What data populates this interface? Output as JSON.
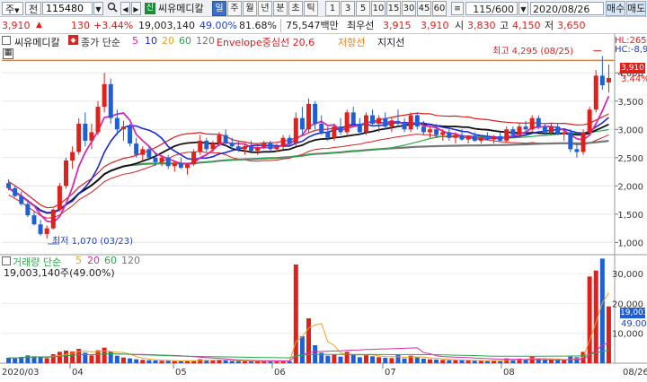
{
  "toolbar": {
    "market": "주",
    "prev_label": "전",
    "code": "115480",
    "mode_badge": "신",
    "stock_name": "씨유메디칼",
    "period_buttons": [
      "일",
      "주",
      "월",
      "년",
      "분",
      "초",
      "틱"
    ],
    "minute_buttons": [
      "1",
      "3",
      "5",
      "10",
      "15",
      "30",
      "45",
      "60"
    ],
    "count": "115/600",
    "date": "2020/08/26",
    "buy_label": "매수",
    "sell_label": "매도"
  },
  "quote": {
    "price": "3,910",
    "change": "130",
    "change_rate": "+3.44%",
    "volume": "19,003,140",
    "ratio1": "49.00%",
    "ratio2": "81.68%",
    "amount": "75,547백만",
    "best_ask_label": "최우선",
    "best_ask": "3,915",
    "best_bid": "3,910",
    "open_label": "시",
    "open": "3,830",
    "high_label": "고",
    "high": "4,150",
    "low_label": "저",
    "low": "3,650"
  },
  "chart_header": {
    "name": "씨유메디칼",
    "ma_label": "종가 단순",
    "ma_periods": [
      "5",
      "10",
      "20",
      "60",
      "120"
    ],
    "envelope": "Envelope중심선 20,6",
    "resistance": "저항선",
    "support": "지지선"
  },
  "annotations": {
    "high_note": "최고 4,295 (08/25)",
    "low_note": "최저 1,070 (03/23)",
    "hl_top": "HL:265,",
    "hc_top": "HC:-8,9",
    "price_tag": "3,910",
    "rate_tag": "3.44%",
    "vol_tag": "19,003",
    "vol_pct_tag": "49.00%"
  },
  "volume_header": {
    "label": "거래량 단순",
    "periods": [
      "5",
      "20",
      "60",
      "120"
    ],
    "summary": "19,003,140주(49.00%)"
  },
  "colors": {
    "up": "#e0201b",
    "down": "#1f5fd6",
    "ma5": "#d62bb0",
    "ma10": "#1c2bd0",
    "ma20": "#f0a020",
    "ma60": "#2aa84a",
    "ma120": "#777777",
    "env_upper": "#d92020",
    "env_mid": "#111111",
    "resistance": "#ff7a00"
  },
  "chart_data": {
    "type": "candlestick",
    "price_axis": {
      "ticks": [
        1000,
        1500,
        2000,
        2500,
        3000,
        3500,
        4000
      ],
      "ylim": [
        800,
        4400
      ]
    },
    "volume_axis": {
      "ticks": [
        10000,
        20000,
        30000
      ],
      "unit": "천주",
      "ylim": [
        0,
        36000
      ]
    },
    "x_labels": [
      "2020/03",
      "04",
      "05",
      "06",
      "07",
      "08",
      "08/26"
    ],
    "high": 4295,
    "low": 1070,
    "last_close": 3910,
    "candles": [
      {
        "o": 2050,
        "h": 2120,
        "l": 1920,
        "c": 1960,
        "v": 1800
      },
      {
        "o": 1960,
        "h": 2000,
        "l": 1800,
        "c": 1820,
        "v": 1600
      },
      {
        "o": 1820,
        "h": 1900,
        "l": 1650,
        "c": 1680,
        "v": 2100
      },
      {
        "o": 1680,
        "h": 1750,
        "l": 1450,
        "c": 1480,
        "v": 2600
      },
      {
        "o": 1480,
        "h": 1560,
        "l": 1300,
        "c": 1320,
        "v": 2300
      },
      {
        "o": 1320,
        "h": 1400,
        "l": 1120,
        "c": 1150,
        "v": 2000
      },
      {
        "o": 1150,
        "h": 1300,
        "l": 1070,
        "c": 1250,
        "v": 1700
      },
      {
        "o": 1250,
        "h": 1600,
        "l": 1230,
        "c": 1580,
        "v": 3000
      },
      {
        "o": 1580,
        "h": 2050,
        "l": 1550,
        "c": 2000,
        "v": 3800
      },
      {
        "o": 2000,
        "h": 2500,
        "l": 1950,
        "c": 2450,
        "v": 4200
      },
      {
        "o": 2450,
        "h": 2700,
        "l": 2300,
        "c": 2600,
        "v": 3900
      },
      {
        "o": 2600,
        "h": 3200,
        "l": 2550,
        "c": 3100,
        "v": 4800
      },
      {
        "o": 3100,
        "h": 3300,
        "l": 2700,
        "c": 2800,
        "v": 3500
      },
      {
        "o": 2800,
        "h": 3100,
        "l": 2650,
        "c": 2950,
        "v": 2600
      },
      {
        "o": 2950,
        "h": 3500,
        "l": 2900,
        "c": 3400,
        "v": 4300
      },
      {
        "o": 3400,
        "h": 4000,
        "l": 3300,
        "c": 3800,
        "v": 5200
      },
      {
        "o": 3800,
        "h": 3900,
        "l": 3100,
        "c": 3200,
        "v": 3900
      },
      {
        "o": 3200,
        "h": 3350,
        "l": 2900,
        "c": 3000,
        "v": 2500
      },
      {
        "o": 3000,
        "h": 3150,
        "l": 2800,
        "c": 3050,
        "v": 1900
      },
      {
        "o": 3050,
        "h": 3100,
        "l": 2700,
        "c": 2750,
        "v": 1600
      },
      {
        "o": 2750,
        "h": 2850,
        "l": 2500,
        "c": 2550,
        "v": 1300
      },
      {
        "o": 2550,
        "h": 2700,
        "l": 2450,
        "c": 2650,
        "v": 1100
      },
      {
        "o": 2650,
        "h": 2700,
        "l": 2450,
        "c": 2500,
        "v": 1000
      },
      {
        "o": 2500,
        "h": 2600,
        "l": 2350,
        "c": 2420,
        "v": 900
      },
      {
        "o": 2420,
        "h": 2550,
        "l": 2350,
        "c": 2500,
        "v": 800
      },
      {
        "o": 2500,
        "h": 2550,
        "l": 2300,
        "c": 2350,
        "v": 800
      },
      {
        "o": 2350,
        "h": 2450,
        "l": 2250,
        "c": 2400,
        "v": 700
      },
      {
        "o": 2400,
        "h": 2500,
        "l": 2300,
        "c": 2320,
        "v": 700
      },
      {
        "o": 2320,
        "h": 2400,
        "l": 2200,
        "c": 2380,
        "v": 700
      },
      {
        "o": 2380,
        "h": 2650,
        "l": 2350,
        "c": 2600,
        "v": 900
      },
      {
        "o": 2600,
        "h": 2900,
        "l": 2550,
        "c": 2800,
        "v": 1300
      },
      {
        "o": 2800,
        "h": 2850,
        "l": 2600,
        "c": 2650,
        "v": 1000
      },
      {
        "o": 2650,
        "h": 2800,
        "l": 2600,
        "c": 2750,
        "v": 900
      },
      {
        "o": 2750,
        "h": 2950,
        "l": 2700,
        "c": 2900,
        "v": 1100
      },
      {
        "o": 2900,
        "h": 3000,
        "l": 2700,
        "c": 2750,
        "v": 900
      },
      {
        "o": 2750,
        "h": 2850,
        "l": 2650,
        "c": 2700,
        "v": 700
      },
      {
        "o": 2700,
        "h": 2800,
        "l": 2600,
        "c": 2650,
        "v": 700
      },
      {
        "o": 2650,
        "h": 2750,
        "l": 2550,
        "c": 2700,
        "v": 650
      },
      {
        "o": 2700,
        "h": 2800,
        "l": 2600,
        "c": 2620,
        "v": 650
      },
      {
        "o": 2620,
        "h": 2700,
        "l": 2550,
        "c": 2680,
        "v": 600
      },
      {
        "o": 2680,
        "h": 2800,
        "l": 2650,
        "c": 2750,
        "v": 650
      },
      {
        "o": 2750,
        "h": 2800,
        "l": 2600,
        "c": 2650,
        "v": 600
      },
      {
        "o": 2650,
        "h": 2750,
        "l": 2600,
        "c": 2700,
        "v": 600
      },
      {
        "o": 2700,
        "h": 2900,
        "l": 2650,
        "c": 2850,
        "v": 900
      },
      {
        "o": 2850,
        "h": 2900,
        "l": 2700,
        "c": 2750,
        "v": 700
      },
      {
        "o": 2750,
        "h": 3300,
        "l": 2700,
        "c": 3200,
        "v": 33000
      },
      {
        "o": 3200,
        "h": 3400,
        "l": 2900,
        "c": 3000,
        "v": 9000
      },
      {
        "o": 3000,
        "h": 3550,
        "l": 2950,
        "c": 3450,
        "v": 15000
      },
      {
        "o": 3450,
        "h": 3500,
        "l": 3000,
        "c": 3100,
        "v": 6000
      },
      {
        "o": 3100,
        "h": 3250,
        "l": 2900,
        "c": 2950,
        "v": 3500
      },
      {
        "o": 2950,
        "h": 3050,
        "l": 2800,
        "c": 2850,
        "v": 2500
      },
      {
        "o": 2850,
        "h": 3100,
        "l": 2800,
        "c": 3050,
        "v": 2800
      },
      {
        "o": 3050,
        "h": 3200,
        "l": 2900,
        "c": 2950,
        "v": 2200
      },
      {
        "o": 2950,
        "h": 3350,
        "l": 2900,
        "c": 3300,
        "v": 3800
      },
      {
        "o": 3300,
        "h": 3400,
        "l": 3050,
        "c": 3100,
        "v": 2900
      },
      {
        "o": 3100,
        "h": 3200,
        "l": 2900,
        "c": 2950,
        "v": 2000
      },
      {
        "o": 2950,
        "h": 3300,
        "l": 2900,
        "c": 3250,
        "v": 3000
      },
      {
        "o": 3250,
        "h": 3350,
        "l": 3050,
        "c": 3100,
        "v": 2300
      },
      {
        "o": 3100,
        "h": 3250,
        "l": 2950,
        "c": 3200,
        "v": 2000
      },
      {
        "o": 3200,
        "h": 3300,
        "l": 3000,
        "c": 3050,
        "v": 1800
      },
      {
        "o": 3050,
        "h": 3200,
        "l": 2950,
        "c": 3150,
        "v": 1700
      },
      {
        "o": 3150,
        "h": 3350,
        "l": 3050,
        "c": 3100,
        "v": 2800
      },
      {
        "o": 3100,
        "h": 3200,
        "l": 2950,
        "c": 3000,
        "v": 1600
      },
      {
        "o": 3000,
        "h": 3300,
        "l": 2950,
        "c": 3250,
        "v": 2500
      },
      {
        "o": 3250,
        "h": 3300,
        "l": 3000,
        "c": 3050,
        "v": 1900
      },
      {
        "o": 3050,
        "h": 3150,
        "l": 2900,
        "c": 2950,
        "v": 1500
      },
      {
        "o": 2950,
        "h": 3050,
        "l": 2850,
        "c": 3000,
        "v": 1300
      },
      {
        "o": 3000,
        "h": 3100,
        "l": 2850,
        "c": 2900,
        "v": 1200
      },
      {
        "o": 2900,
        "h": 3000,
        "l": 2800,
        "c": 2950,
        "v": 1100
      },
      {
        "o": 2950,
        "h": 3000,
        "l": 2800,
        "c": 2850,
        "v": 1000
      },
      {
        "o": 2850,
        "h": 2950,
        "l": 2750,
        "c": 2900,
        "v": 1000
      },
      {
        "o": 2900,
        "h": 3000,
        "l": 2800,
        "c": 2820,
        "v": 900
      },
      {
        "o": 2820,
        "h": 2900,
        "l": 2750,
        "c": 2880,
        "v": 900
      },
      {
        "o": 2880,
        "h": 2950,
        "l": 2780,
        "c": 2800,
        "v": 800
      },
      {
        "o": 2800,
        "h": 2900,
        "l": 2750,
        "c": 2850,
        "v": 800
      },
      {
        "o": 2850,
        "h": 2950,
        "l": 2800,
        "c": 2820,
        "v": 700
      },
      {
        "o": 2820,
        "h": 2900,
        "l": 2750,
        "c": 2880,
        "v": 800
      },
      {
        "o": 2880,
        "h": 2950,
        "l": 2780,
        "c": 2800,
        "v": 700
      },
      {
        "o": 2800,
        "h": 3050,
        "l": 2780,
        "c": 3000,
        "v": 1600
      },
      {
        "o": 3000,
        "h": 3050,
        "l": 2850,
        "c": 2900,
        "v": 1100
      },
      {
        "o": 2900,
        "h": 3100,
        "l": 2850,
        "c": 3050,
        "v": 1500
      },
      {
        "o": 3050,
        "h": 3150,
        "l": 2950,
        "c": 3000,
        "v": 1300
      },
      {
        "o": 3000,
        "h": 3250,
        "l": 2950,
        "c": 3200,
        "v": 2200
      },
      {
        "o": 3200,
        "h": 3250,
        "l": 3000,
        "c": 3050,
        "v": 1600
      },
      {
        "o": 3050,
        "h": 3100,
        "l": 2900,
        "c": 2950,
        "v": 1200
      },
      {
        "o": 2950,
        "h": 3100,
        "l": 2900,
        "c": 3050,
        "v": 1100
      },
      {
        "o": 3050,
        "h": 3100,
        "l": 2900,
        "c": 2920,
        "v": 1000
      },
      {
        "o": 2920,
        "h": 3000,
        "l": 2800,
        "c": 2950,
        "v": 1000
      },
      {
        "o": 2950,
        "h": 3000,
        "l": 2600,
        "c": 2650,
        "v": 2200
      },
      {
        "o": 2650,
        "h": 2750,
        "l": 2500,
        "c": 2600,
        "v": 2000
      },
      {
        "o": 2600,
        "h": 3000,
        "l": 2550,
        "c": 2950,
        "v": 3800
      },
      {
        "o": 2950,
        "h": 3400,
        "l": 2900,
        "c": 3350,
        "v": 29000
      },
      {
        "o": 3350,
        "h": 4050,
        "l": 3300,
        "c": 3950,
        "v": 31000
      },
      {
        "o": 3950,
        "h": 4295,
        "l": 3700,
        "c": 3780,
        "v": 35000
      },
      {
        "o": 3830,
        "h": 4150,
        "l": 3650,
        "c": 3910,
        "v": 19003
      }
    ],
    "envelope_upper_value": 3550,
    "resistance_value": 4220
  }
}
